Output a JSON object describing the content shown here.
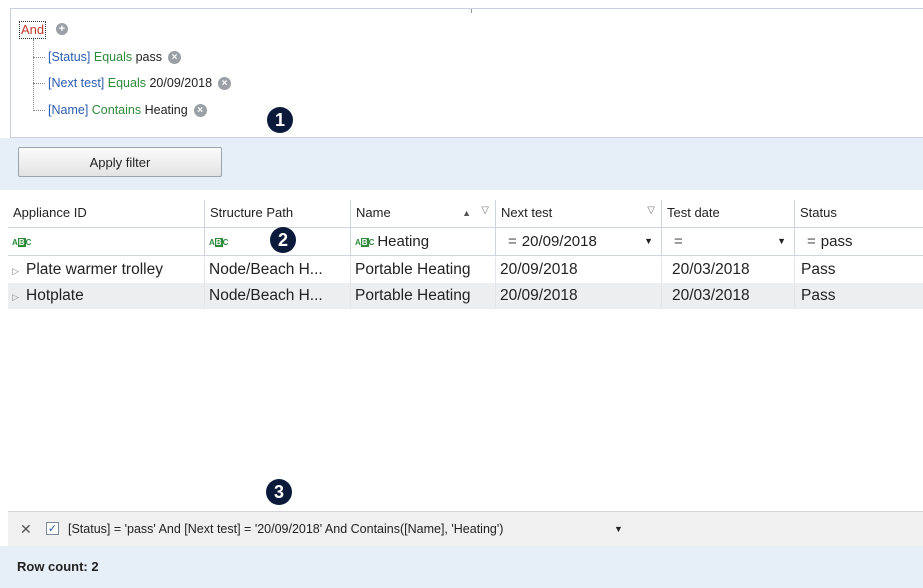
{
  "filter_builder": {
    "root_operator": "And",
    "conditions": [
      {
        "field": "[Status]",
        "operator": "Equals",
        "value": "pass"
      },
      {
        "field": "[Next test]",
        "operator": "Equals",
        "value": "20/09/2018"
      },
      {
        "field": "[Name]",
        "operator": "Contains",
        "value": "Heating"
      }
    ]
  },
  "callouts": {
    "one": "1",
    "two": "2",
    "three": "3"
  },
  "apply_button": "Apply filter",
  "grid": {
    "columns": [
      "Appliance ID",
      "Structure Path",
      "Name",
      "Next test",
      "Test date",
      "Status"
    ],
    "filter_row": {
      "name_value": "Heating",
      "next_test_value": "20/09/2018",
      "status_value": "pass",
      "eq_symbol": "="
    },
    "rows": [
      [
        "Plate warmer trolley",
        "Node/Beach H...",
        "Portable Heating",
        "20/09/2018",
        "20/03/2018",
        "Pass"
      ],
      [
        "Hotplate",
        "Node/Beach H...",
        "Portable Heating",
        "20/09/2018",
        "20/03/2018",
        "Pass"
      ]
    ]
  },
  "filter_expression": "[Status] = 'pass' And [Next test] = '20/09/2018' And Contains([Name], 'Heating')",
  "row_count": "Row count: 2"
}
